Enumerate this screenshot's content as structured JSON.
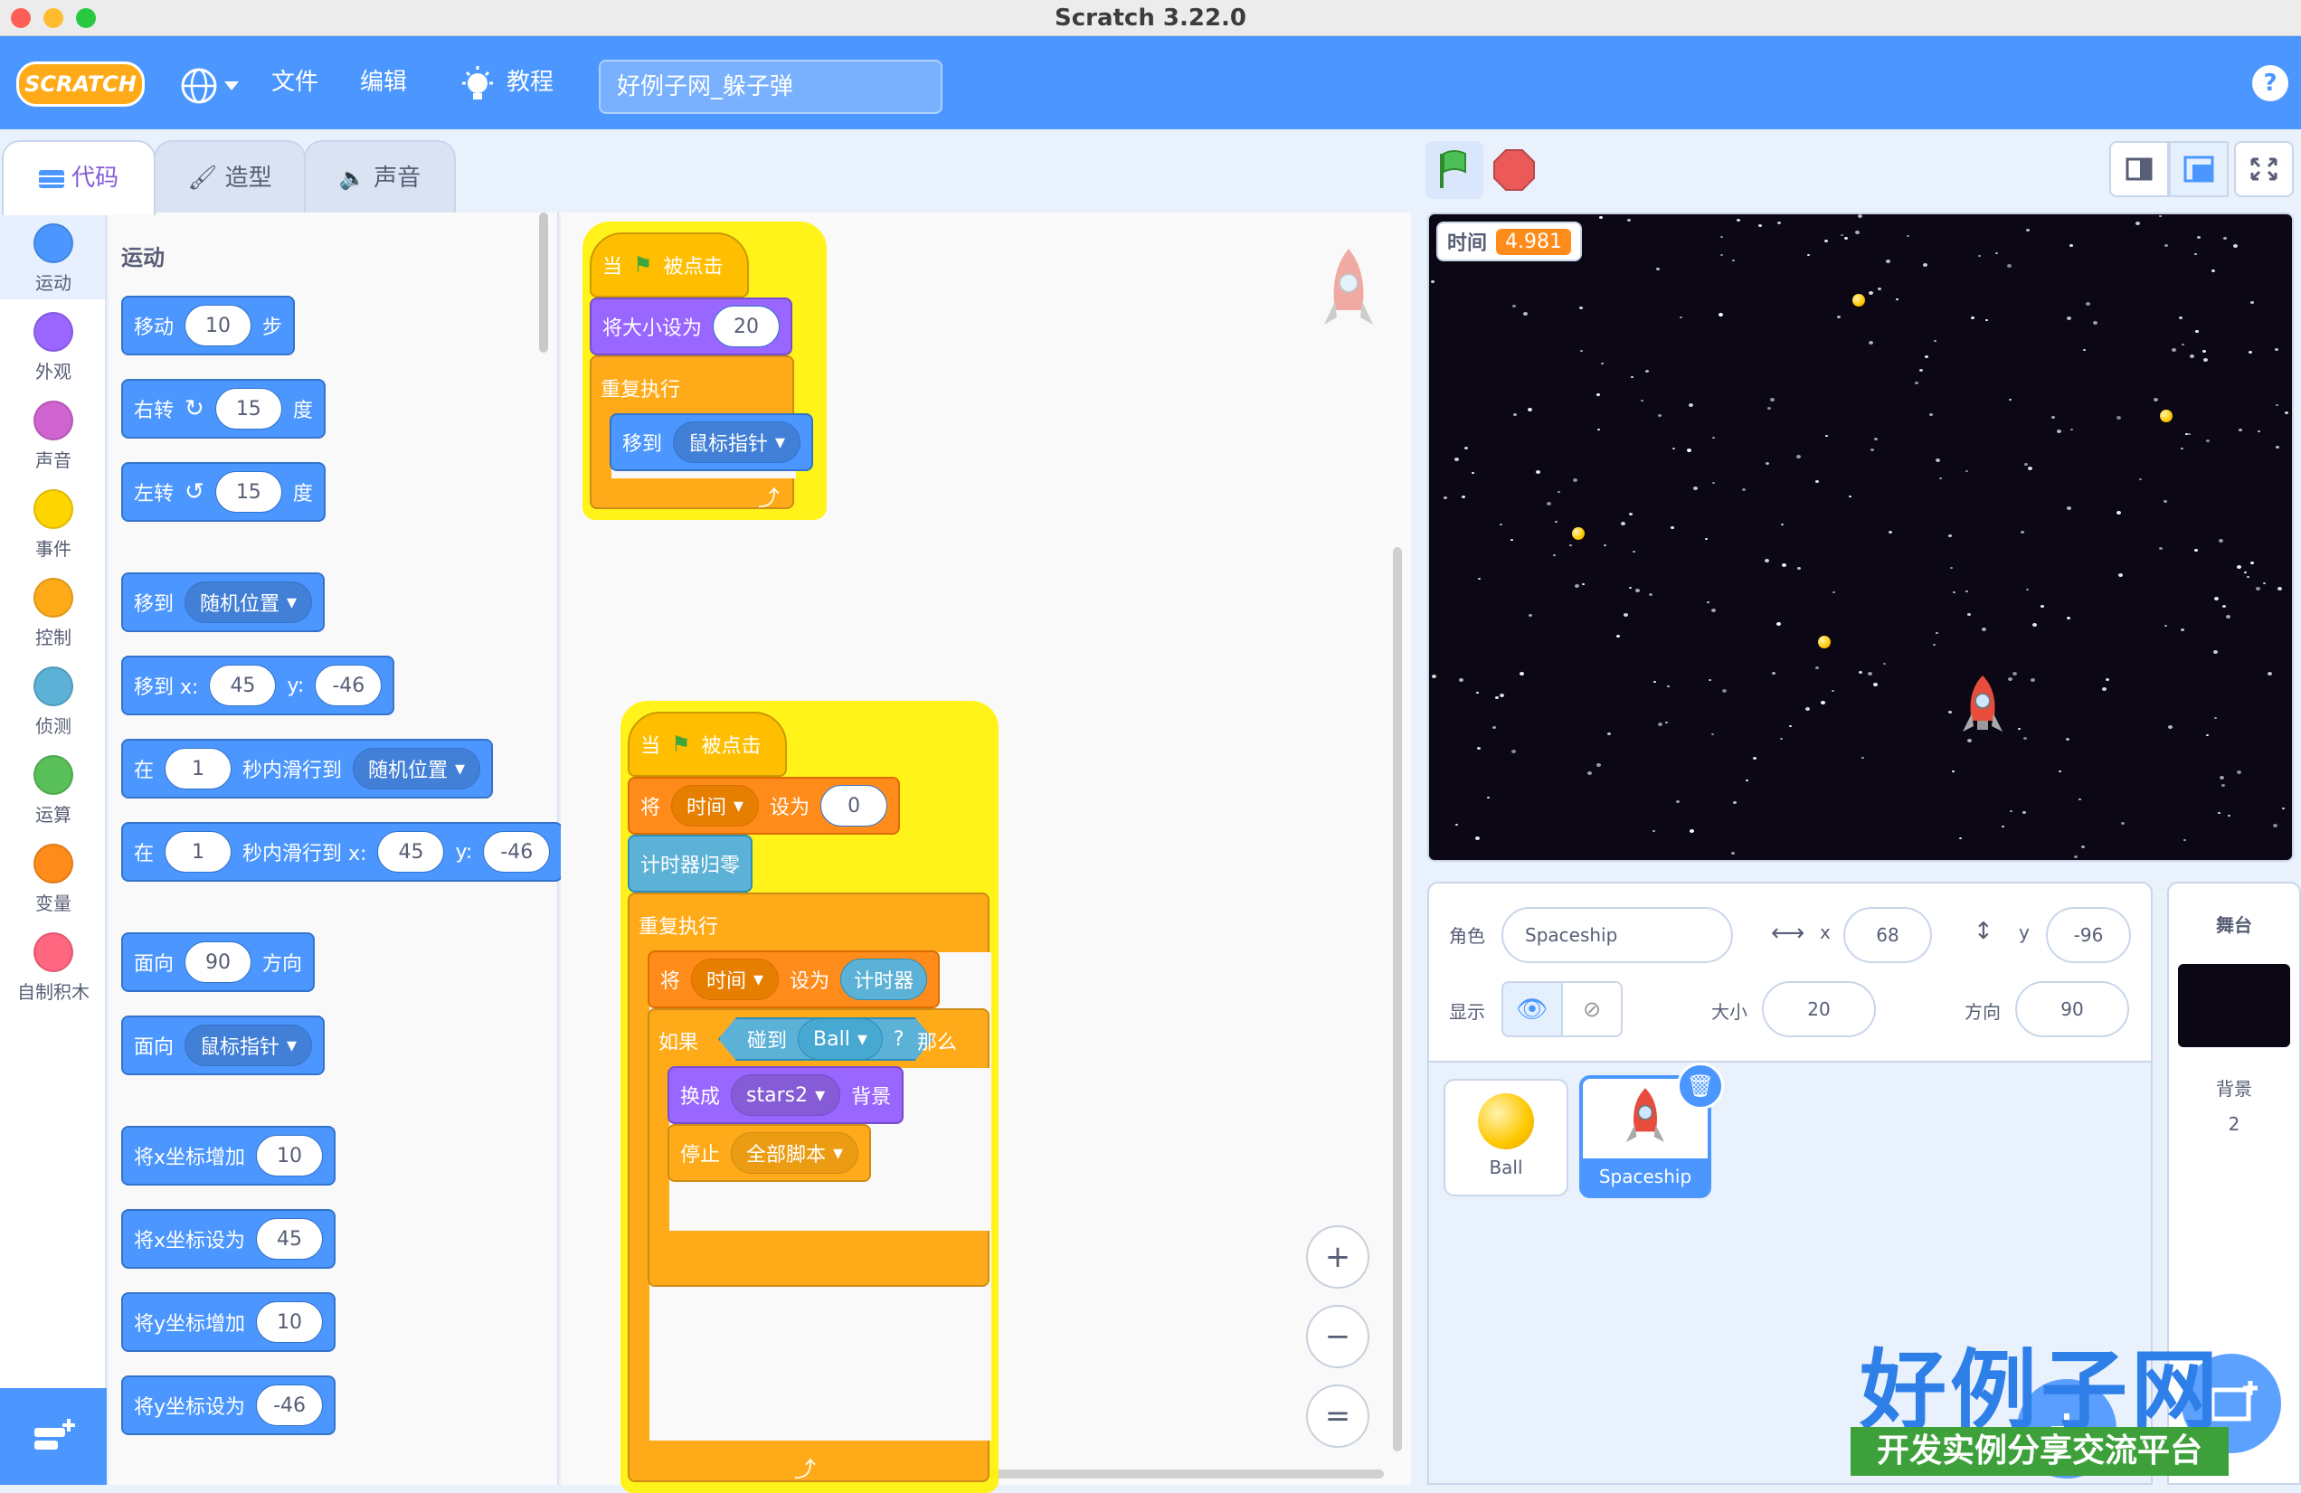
{
  "window": {
    "title": "Scratch 3.22.0"
  },
  "menubar": {
    "logo": "SCRATCH",
    "file": "文件",
    "edit": "编辑",
    "tutorials": "教程",
    "project_title": "好例子网_躲子弹",
    "help": "?"
  },
  "tabs": {
    "code": "代码",
    "costumes": "造型",
    "sounds": "声音"
  },
  "categories": [
    {
      "label": "运动",
      "color": "#4c97ff"
    },
    {
      "label": "外观",
      "color": "#9966ff"
    },
    {
      "label": "声音",
      "color": "#cf63cf"
    },
    {
      "label": "事件",
      "color": "#ffd500"
    },
    {
      "label": "控制",
      "color": "#ffab19"
    },
    {
      "label": "侦测",
      "color": "#5cb1d6"
    },
    {
      "label": "运算",
      "color": "#59c059"
    },
    {
      "label": "变量",
      "color": "#ff8c1a"
    },
    {
      "label": "自制积木",
      "color": "#ff6680"
    }
  ],
  "palette": {
    "heading": "运动",
    "move": {
      "a": "移动",
      "n": "10",
      "b": "步"
    },
    "turn_right": {
      "a": "右转",
      "n": "15",
      "b": "度"
    },
    "turn_left": {
      "a": "左转",
      "n": "15",
      "b": "度"
    },
    "goto": {
      "a": "移到",
      "d": "随机位置"
    },
    "goto_xy": {
      "a": "移到 x:",
      "x": "45",
      "yl": "y:",
      "y": "-46"
    },
    "glide": {
      "a": "在",
      "n": "1",
      "b": "秒内滑行到",
      "d": "随机位置"
    },
    "glide_xy": {
      "a": "在",
      "n": "1",
      "b": "秒内滑行到 x:",
      "x": "45",
      "yl": "y:",
      "y": "-46"
    },
    "point_dir": {
      "a": "面向",
      "n": "90",
      "b": "方向"
    },
    "point_to": {
      "a": "面向",
      "d": "鼠标指针"
    },
    "change_x": {
      "a": "将x坐标增加",
      "n": "10"
    },
    "set_x": {
      "a": "将x坐标设为",
      "n": "45"
    },
    "change_y": {
      "a": "将y坐标增加",
      "n": "10"
    },
    "set_y": {
      "a": "将y坐标设为",
      "n": "-46"
    }
  },
  "script1": {
    "when_a": "当",
    "when_b": "被点击",
    "size_a": "将大小设为",
    "size_n": "20",
    "forever": "重复执行",
    "goto_a": "移到",
    "goto_d": "鼠标指针"
  },
  "script2": {
    "when_a": "当",
    "when_b": "被点击",
    "set_a": "将",
    "set_var": "时间",
    "set_b": "设为",
    "set_n": "0",
    "reset_timer": "计时器归零",
    "forever": "重复执行",
    "set2_a": "将",
    "set2_var": "时间",
    "set2_b": "设为",
    "set2_rep": "计时器",
    "if_a": "如果",
    "touch_a": "碰到",
    "touch_d": "Ball",
    "touch_q": "?",
    "if_b": "那么",
    "switch_a": "换成",
    "switch_d": "stars2",
    "switch_b": "背景",
    "stop_a": "停止",
    "stop_d": "全部脚本"
  },
  "zoom": {
    "in": "+",
    "out": "−",
    "reset": "="
  },
  "stage": {
    "monitor_label": "时间",
    "monitor_value": "4.981"
  },
  "sprite_info": {
    "sprite_label": "角色",
    "sprite_name": "Spaceship",
    "x_label": "x",
    "x": "68",
    "y_label": "y",
    "y": "-96",
    "show_label": "显示",
    "size_label": "大小",
    "size": "20",
    "dir_label": "方向",
    "dir": "90"
  },
  "sprites": [
    {
      "name": "Ball"
    },
    {
      "name": "Spaceship"
    }
  ],
  "stage_panel": {
    "title": "舞台",
    "backdrops_label": "背景",
    "backdrops_count": "2"
  },
  "branding": {
    "logo": "好例子网",
    "tagline": "开发实例分享交流平台"
  },
  "colors": {
    "motion": "#4c97ff",
    "looks": "#9966ff",
    "events": "#ffbf00",
    "control": "#ffab19",
    "sensing": "#5cb1d6",
    "variables": "#ff8c1a",
    "menubar": "#4c97ff"
  }
}
